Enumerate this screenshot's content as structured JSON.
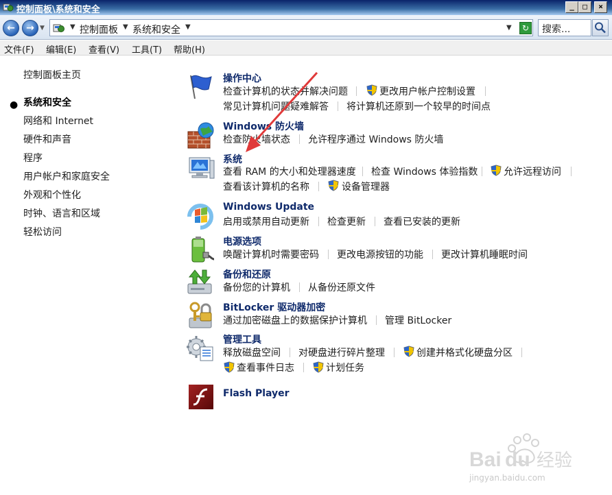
{
  "window": {
    "title": "控制面板\\系统和安全"
  },
  "address": {
    "crumbs": [
      "控制面板",
      "系统和安全"
    ],
    "search_placeholder": "搜索..."
  },
  "menu": [
    "文件(F)",
    "编辑(E)",
    "查看(V)",
    "工具(T)",
    "帮助(H)"
  ],
  "sidebar": {
    "home": "控制面板主页",
    "items": [
      "系统和安全",
      "网络和 Internet",
      "硬件和声音",
      "程序",
      "用户帐户和家庭安全",
      "外观和个性化",
      "时钟、语言和区域",
      "轻松访问"
    ]
  },
  "categories": [
    {
      "title": "操作中心",
      "icon": "action-center-flag-icon",
      "links": [
        "检查计算机的状态并解决问题",
        "更改用户帐户控制设置",
        "常见计算机问题疑难解答",
        "将计算机还原到一个较早的时间点"
      ]
    },
    {
      "title": "Windows 防火墙",
      "icon": "firewall-icon",
      "links": [
        "检查防火墙状态",
        "允许程序通过 Windows 防火墙"
      ]
    },
    {
      "title": "系统",
      "icon": "system-computer-icon",
      "links": [
        "查看 RAM 的大小和处理器速度",
        "检查 Windows 体验指数",
        "允许远程访问",
        "查看该计算机的名称",
        "设备管理器"
      ]
    },
    {
      "title": "Windows Update",
      "icon": "windows-update-icon",
      "links": [
        "启用或禁用自动更新",
        "检查更新",
        "查看已安装的更新"
      ]
    },
    {
      "title": "电源选项",
      "icon": "power-options-battery-icon",
      "links": [
        "唤醒计算机时需要密码",
        "更改电源按钮的功能",
        "更改计算机睡眠时间"
      ]
    },
    {
      "title": "备份和还原",
      "icon": "backup-restore-icon",
      "links": [
        "备份您的计算机",
        "从备份还原文件"
      ]
    },
    {
      "title": "BitLocker 驱动器加密",
      "icon": "bitlocker-icon",
      "links": [
        "通过加密磁盘上的数据保护计算机",
        "管理 BitLocker"
      ]
    },
    {
      "title": "管理工具",
      "icon": "admin-tools-icon",
      "links": [
        "释放磁盘空间",
        "对硬盘进行碎片整理",
        "创建并格式化硬盘分区",
        "查看事件日志",
        "计划任务"
      ]
    },
    {
      "title": "Flash Player",
      "icon": "flash-player-icon",
      "links": []
    }
  ],
  "watermark": {
    "logo": "Baidu经验",
    "url": "jingyan.baidu.com"
  },
  "colors": {
    "title_link": "#0f2a6b",
    "accent": "#2a64b8",
    "arrow": "#e03a3a"
  }
}
